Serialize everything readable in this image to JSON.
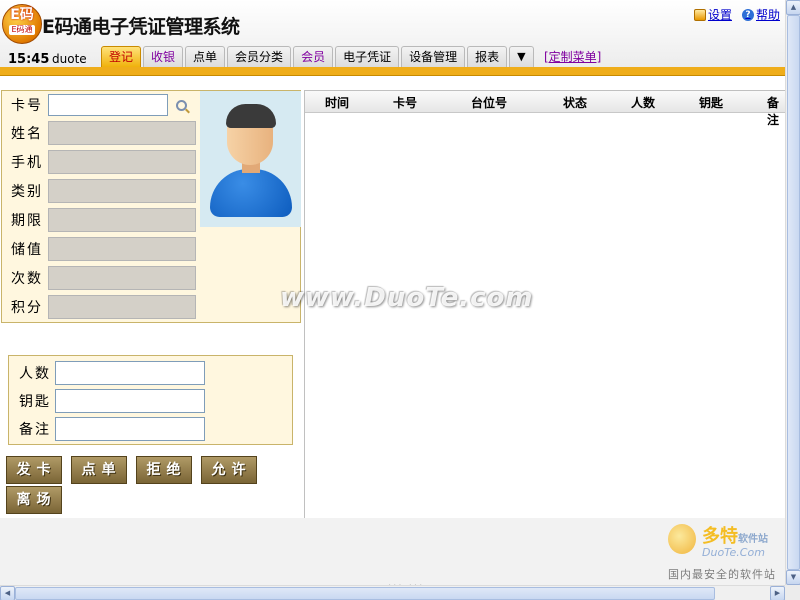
{
  "app": {
    "logo_top": "E码",
    "logo_bottom": "E码通",
    "title": "E码通电子凭证管理系统"
  },
  "top_links": {
    "settings": "设置",
    "help": "帮助"
  },
  "status": {
    "time": "15:45",
    "user": "duote"
  },
  "tabs": [
    {
      "label": "登记"
    },
    {
      "label": "收银"
    },
    {
      "label": "点单"
    },
    {
      "label": "会员分类"
    },
    {
      "label": "会员"
    },
    {
      "label": "电子凭证"
    },
    {
      "label": "设备管理"
    },
    {
      "label": "报表"
    },
    {
      "label": "▼"
    }
  ],
  "custom_menu": "[定制菜单]",
  "member_form": {
    "card_no": {
      "label": "卡号",
      "value": ""
    },
    "name": "姓名",
    "phone": "手机",
    "category": "类别",
    "term": "期限",
    "stored_value": "储值",
    "count": "次数",
    "points": "积分"
  },
  "extra_form": {
    "people": "人数",
    "key": "钥匙",
    "remark": "备注"
  },
  "actions": {
    "issue": "发卡",
    "order": "点单",
    "reject": "拒绝",
    "allow": "允许",
    "leave": "离场"
  },
  "table": {
    "headers": [
      "时间",
      "卡号",
      "台位号",
      "状态",
      "人数",
      "钥匙",
      "备注"
    ],
    "rows": []
  },
  "footer": "... ...",
  "watermarks": {
    "center": "www.DuoTe.com",
    "corner_name": "多特",
    "corner_name_small": "软件站",
    "corner_url": "DuoTe.Com",
    "corner_slogan": "国内最安全的软件站"
  },
  "colors": {
    "accent": "#efad1a",
    "active_tab": "#f0b10c",
    "panel_bg": "#fff7df",
    "action_button": "#8a7543"
  }
}
